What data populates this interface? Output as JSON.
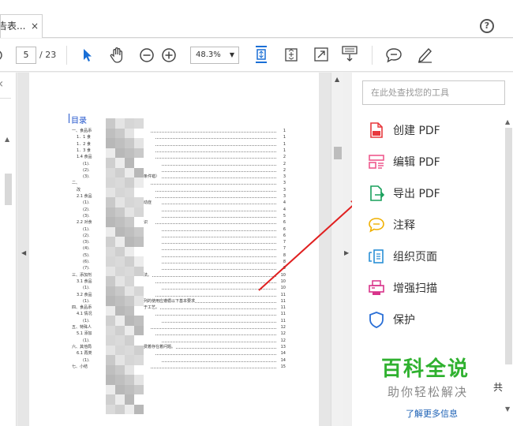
{
  "tab": {
    "title": "告表...",
    "close": "×"
  },
  "help_icon": "?",
  "toolbar": {
    "page_current": "5",
    "page_total": "/ 23",
    "zoom": "48.3%",
    "zoom_caret": "▼"
  },
  "right_panel": {
    "search_placeholder": "在此处查找您的工具",
    "tools": [
      {
        "label": "创建 PDF",
        "icon": "create-pdf-icon",
        "color": "#e8383d"
      },
      {
        "label": "编辑 PDF",
        "icon": "edit-pdf-icon",
        "color": "#ee5a8e"
      },
      {
        "label": "导出 PDF",
        "icon": "export-pdf-icon",
        "color": "#19a05c"
      },
      {
        "label": "注释",
        "icon": "comment-icon",
        "color": "#f0b000"
      },
      {
        "label": "组织页面",
        "icon": "organize-pages-icon",
        "color": "#2a8fd6"
      },
      {
        "label": "增强扫描",
        "icon": "enhance-scan-icon",
        "color": "#d8338a"
      },
      {
        "label": "保护",
        "icon": "protect-icon",
        "color": "#2a6fd6"
      }
    ],
    "share_fragment": "共",
    "learn_more": "了解更多信息"
  },
  "watermark": {
    "line1": "百科全说",
    "line2": "助你轻松解决"
  },
  "document": {
    "toc_title": "目录",
    "toc_rows": [
      {
        "text": "一、食品添",
        "page": "1"
      },
      {
        "text": "1．1 食",
        "page": "1"
      },
      {
        "text": "1．2 食",
        "page": "1"
      },
      {
        "text": "1．3 食",
        "page": "1"
      },
      {
        "text": "1.4 食品",
        "page": "2"
      },
      {
        "text": "(1).",
        "page": "2"
      },
      {
        "text": "(2).",
        "page": "2"
      },
      {
        "text": "(3).",
        "page": "3"
      },
      {
        "text": "二、",
        "page": "3"
      },
      {
        "text": "改",
        "page": "3"
      },
      {
        "text": "2.1 食品",
        "page": "3"
      },
      {
        "text": "(1).",
        "page": "4"
      },
      {
        "text": "(2).",
        "page": "4"
      },
      {
        "text": "(3).",
        "page": "5"
      },
      {
        "text": "2.2 对食",
        "page": "6"
      },
      {
        "text": "(1).",
        "page": "6"
      },
      {
        "text": "(2).",
        "page": "6"
      },
      {
        "text": "(3).",
        "page": "7"
      },
      {
        "text": "(4).",
        "page": "7"
      },
      {
        "text": "(5).",
        "page": "8"
      },
      {
        "text": "(6).",
        "page": "8"
      },
      {
        "text": "(7).",
        "page": "9"
      },
      {
        "text": "三、添加剂",
        "page": "10"
      },
      {
        "text": "3.1 食品",
        "page": "10"
      },
      {
        "text": "(1).",
        "page": "10"
      },
      {
        "text": "3.2 食品",
        "page": "11"
      },
      {
        "text": "(1).",
        "page": "11"
      },
      {
        "text": "四、食品添",
        "page": "11"
      },
      {
        "text": "4.1 情况",
        "page": "11"
      },
      {
        "text": "(1).",
        "page": "11"
      },
      {
        "text": "五、特殊人",
        "page": "12"
      },
      {
        "text": "5.1 添加",
        "page": "12"
      },
      {
        "text": "(1).",
        "page": "12"
      },
      {
        "text": "六、其他局",
        "page": "13"
      },
      {
        "text": "6.1 再类",
        "page": "14"
      },
      {
        "text": "(1).",
        "page": "14"
      },
      {
        "text": "七、小结",
        "page": "15"
      }
    ],
    "fragments": [
      {
        "row": 7,
        "text": "条件错）"
      },
      {
        "row": 11,
        "text": "动症"
      },
      {
        "row": 14,
        "text": "识"
      },
      {
        "row": 22,
        "text": "法。"
      },
      {
        "row": 26,
        "text": "列的使用应遵循以下基本要求"
      },
      {
        "row": 27,
        "text": "于工艺。"
      },
      {
        "row": 33,
        "text": "费着存在着问题。"
      }
    ]
  }
}
